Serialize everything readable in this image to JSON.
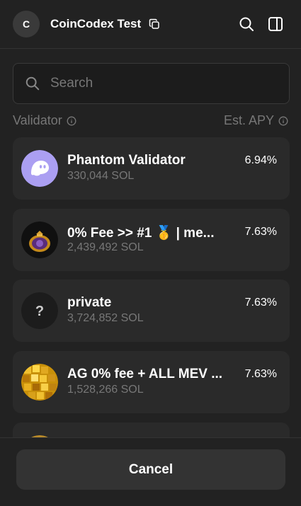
{
  "header": {
    "avatar_initial": "C",
    "account_name": "CoinCodex Test",
    "copy_icon": "copy-icon",
    "search_icon": "search-icon",
    "panel_icon": "sidebar-panel-icon"
  },
  "search": {
    "placeholder": "Search",
    "value": ""
  },
  "columns": {
    "validator": "Validator",
    "apy": "Est. APY"
  },
  "validators": [
    {
      "name": "Phantom Validator",
      "stake": "330,044 SOL",
      "apy": "6.94%",
      "logo": "phantom-ghost"
    },
    {
      "name": "0% Fee >> #1 🥇 | me...",
      "stake": "2,439,492 SOL",
      "apy": "7.63%",
      "logo": "money-bag"
    },
    {
      "name": "private",
      "stake": "3,724,852 SOL",
      "apy": "7.63%",
      "logo": "question-mark"
    },
    {
      "name": "AG 0% fee + ALL MEV ...",
      "stake": "1,528,266 SOL",
      "apy": "7.63%",
      "logo": "gold-disco-ball"
    }
  ],
  "footer": {
    "cancel_label": "Cancel"
  },
  "colors": {
    "background": "#222222",
    "card": "#2a2a2a",
    "muted_text": "#777777",
    "phantom_purple": "#ab9ff2"
  }
}
